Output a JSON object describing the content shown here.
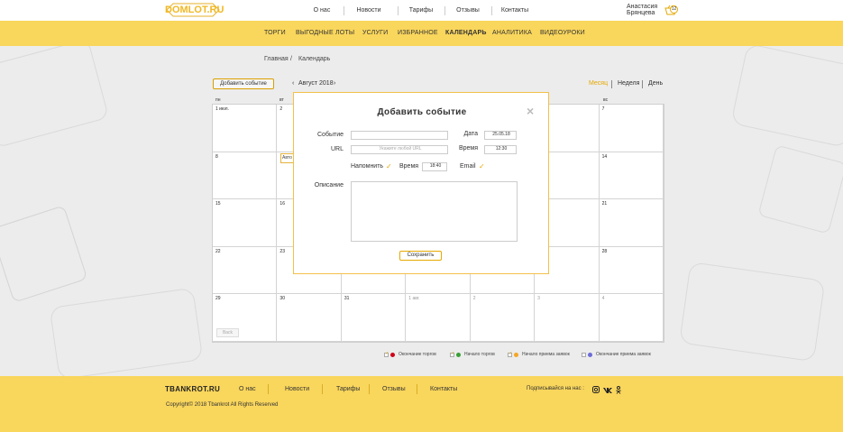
{
  "header": {
    "logo": "DOMLOT.RU",
    "nav": [
      "О нас",
      "Новости",
      "Тарифы",
      "Отзывы",
      "Контакты"
    ],
    "user_name": "Анастасия Брянцева",
    "cart_count": "12"
  },
  "yellow_nav": [
    "ТОРГИ",
    "ВЫГОДНЫЕ  ЛОТЫ",
    "УСЛУГИ",
    "ИЗБРАННОЕ",
    "КАЛЕНДАРЬ",
    "АНАЛИТИКА",
    "ВИДЕОУРОКИ"
  ],
  "breadcrumb": {
    "home": "Главная",
    "sep": "/",
    "current": "Календарь"
  },
  "toolbar": {
    "add_event": "Добавить событие",
    "prev": "‹",
    "month_label": "Август 2018",
    "next": "›",
    "views": [
      "Месяц",
      "Неделя",
      "День"
    ]
  },
  "day_headers": [
    "пн",
    "вт",
    "ср",
    "чт",
    "пт",
    "сб",
    "вс"
  ],
  "calendar": {
    "weeks": [
      [
        "1 июл.",
        "2",
        "",
        "",
        "",
        "",
        "7"
      ],
      [
        "8",
        "",
        "",
        "",
        "",
        "",
        "14"
      ],
      [
        "15",
        "16",
        "",
        "",
        "",
        "",
        "21"
      ],
      [
        "22",
        "23",
        "",
        "",
        "",
        "",
        "28"
      ],
      [
        "29",
        "30",
        "31",
        "1 авг.",
        "2",
        "3",
        "4"
      ]
    ],
    "auto_event": "Авто",
    "back": "Back"
  },
  "legend": [
    {
      "label": "Окончание торгов",
      "color": "#d0021b",
      "checked": true
    },
    {
      "label": "Начало торгов",
      "color": "#3aa035",
      "checked": true
    },
    {
      "label": "Начало приема заявок",
      "color": "#f5a623",
      "checked": true
    },
    {
      "label": "Окончание приема заявок",
      "color": "#6c6cd8",
      "checked": false
    }
  ],
  "modal": {
    "title": "Добавить событие",
    "close": "×",
    "event_label": "Событие",
    "event_value": "",
    "date_label": "Дата",
    "date_value": "25.05.18",
    "url_label": "URL",
    "url_placeholder": "Укажите любой URL",
    "time_label_top": "Время",
    "time_value_top": "12:30",
    "remind_label": "Напомнить",
    "remind_checked": "✓",
    "time_label": "Время",
    "time_value": "18:40",
    "email_label": "Email",
    "email_checked": "✓",
    "desc_label": "Описание",
    "save": "Сохранить"
  },
  "footer": {
    "brand": "TBANKROT.RU",
    "nav": [
      "О нас",
      "Новости",
      "Тарифы",
      "Отзывы",
      "Контакты"
    ],
    "subscribe": "Подписывайся на нас :",
    "social": [
      "instagram-icon",
      "vk-icon",
      "ok-icon"
    ],
    "copyright": "Copyright© 2018 Tbankrot All Rights Reserved"
  }
}
